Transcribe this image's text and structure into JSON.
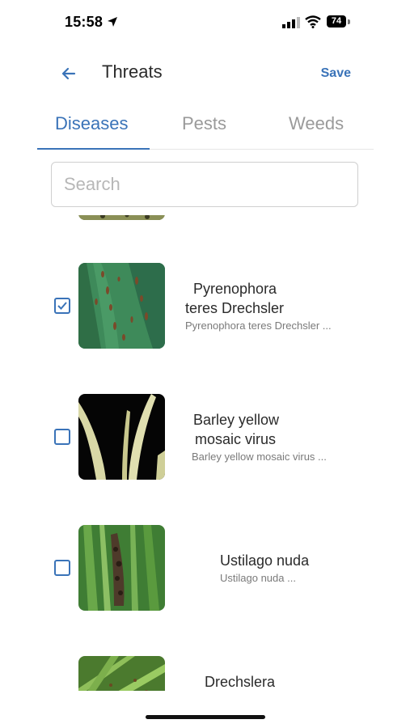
{
  "status": {
    "time": "15:58",
    "battery": "74"
  },
  "header": {
    "title": "Threats",
    "save_label": "Save"
  },
  "tabs": [
    {
      "label": "Diseases",
      "active": true
    },
    {
      "label": "Pests",
      "active": false
    },
    {
      "label": "Weeds",
      "active": false
    }
  ],
  "search": {
    "placeholder": "Search",
    "value": ""
  },
  "threats": [
    {
      "name_line1": "Pyrenophora",
      "name_line2": "teres Drechsler",
      "subtitle": "Pyrenophora teres Drechsler ...",
      "checked": true
    },
    {
      "name_line1": "Barley yellow",
      "name_line2": "mosaic virus",
      "subtitle": "Barley yellow mosaic virus ...",
      "checked": false
    },
    {
      "name_line1": "Ustilago nuda",
      "name_line2": "",
      "subtitle": "Ustilago nuda ...",
      "checked": false
    },
    {
      "name_line1": "Drechslera",
      "name_line2": "",
      "subtitle": "",
      "checked": false
    }
  ],
  "colors": {
    "accent": "#3a73b8",
    "tab_inactive": "#9a9a9a"
  }
}
